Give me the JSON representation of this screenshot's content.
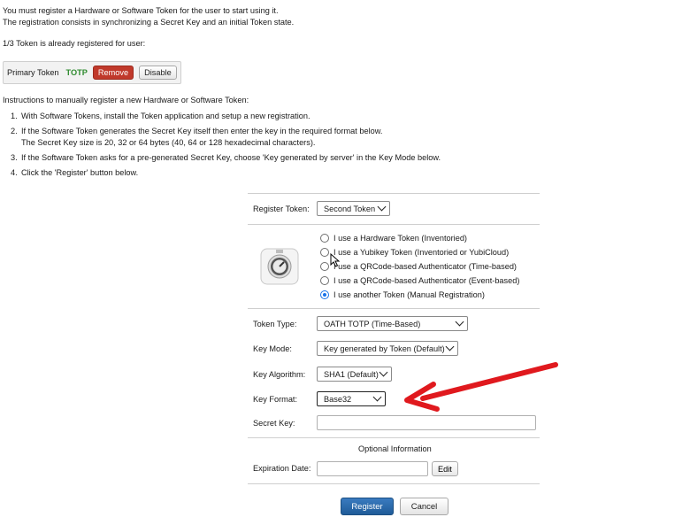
{
  "intro": {
    "line1": "You must register a Hardware or Software Token for the user to start using it.",
    "line2": "The registration consists in synchronizing a Secret Key and an initial Token state."
  },
  "registered_text": "1/3 Token is already registered for user:",
  "primary_token": {
    "name": "Primary Token",
    "type": "TOTP",
    "remove_label": "Remove",
    "disable_label": "Disable"
  },
  "instructions": {
    "title": "Instructions to manually register a new Hardware or Software Token:",
    "items": [
      {
        "num": "1.",
        "text": "With Software Tokens, install the Token application and setup a new registration."
      },
      {
        "num": "2.",
        "text": "If the Software Token generates the Secret Key itself then enter the key in the required format below.",
        "text2": "The Secret Key size is 20, 32 or 64 bytes (40, 64 or 128 hexadecimal characters)."
      },
      {
        "num": "3.",
        "text": "If the Software Token asks for a pre-generated Secret Key, choose 'Key generated by server' in the Key Mode below."
      },
      {
        "num": "4.",
        "text": "Click the 'Register' button below."
      }
    ]
  },
  "form": {
    "register_token_label": "Register Token:",
    "register_token_value": "Second Token",
    "token_options": [
      {
        "label": "I use a Hardware Token (Inventoried)",
        "checked": false
      },
      {
        "label": "I use a Yubikey Token (Inventoried or YubiCloud)",
        "checked": false
      },
      {
        "label": "I use a QRCode-based Authenticator (Time-based)",
        "checked": false
      },
      {
        "label": "I use a QRCode-based Authenticator (Event-based)",
        "checked": false
      },
      {
        "label": "I use another Token (Manual Registration)",
        "checked": true
      }
    ],
    "token_type_label": "Token Type:",
    "token_type_value": "OATH TOTP (Time-Based)",
    "key_mode_label": "Key Mode:",
    "key_mode_value": "Key generated by Token (Default)",
    "key_algorithm_label": "Key Algorithm:",
    "key_algorithm_value": "SHA1 (Default)",
    "key_format_label": "Key Format:",
    "key_format_value": "Base32",
    "secret_key_label": "Secret Key:",
    "secret_key_value": "",
    "optional_info_title": "Optional Information",
    "expiration_label": "Expiration Date:",
    "expiration_value": "",
    "edit_label": "Edit",
    "register_label": "Register",
    "cancel_label": "Cancel"
  },
  "colors": {
    "remove_bg": "#c0392b",
    "totp_green": "#2e8b2e",
    "register_blue": "#1f5b99",
    "arrow_red": "#e0191e",
    "radio_selected": "#1a73e8"
  },
  "icons": {
    "token_app": "safe-dial-icon",
    "annotation": "red-arrow-icon",
    "cursor": "mouse-cursor-icon"
  }
}
